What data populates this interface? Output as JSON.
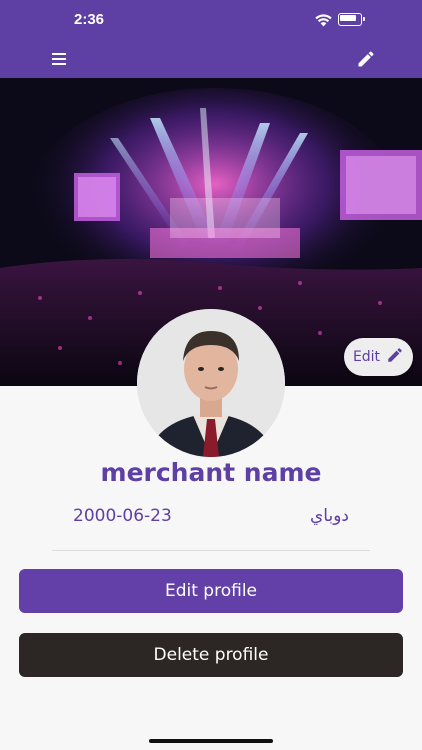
{
  "status_bar": {
    "time": "2:36",
    "icons": [
      "wifi-icon",
      "battery-icon"
    ]
  },
  "app_bar": {
    "menu_icon": "hamburger-menu-icon",
    "edit_icon": "pencil-icon",
    "background_color": "#5e3fa3"
  },
  "cover": {
    "image": "concert stage with lights and crowd",
    "edit_button_label": "Edit",
    "edit_icon": "pencil-icon"
  },
  "profile": {
    "avatar": "profile photo of man in suit",
    "name": "merchant name",
    "date": "2000-06-23",
    "city": "دوباي"
  },
  "actions": {
    "edit_profile_label": "Edit profile",
    "delete_profile_label": "Delete profile"
  },
  "colors": {
    "accent": "#5e3fa3",
    "delete_button": "#2c2724",
    "background": "#f7f7f8"
  }
}
